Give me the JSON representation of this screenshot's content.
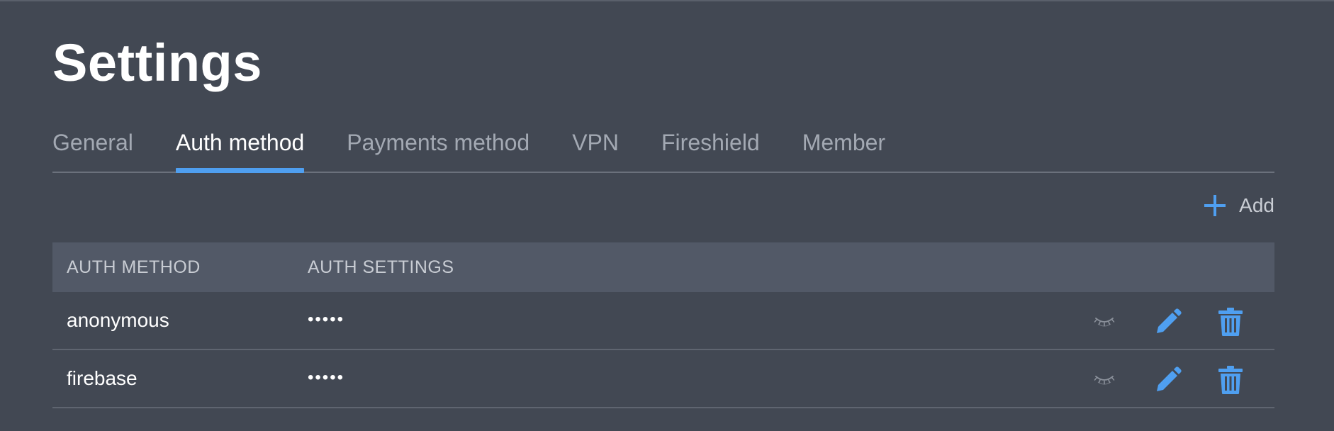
{
  "page": {
    "title": "Settings"
  },
  "tabs": [
    {
      "label": "General",
      "active": false
    },
    {
      "label": "Auth method",
      "active": true
    },
    {
      "label": "Payments method",
      "active": false
    },
    {
      "label": "VPN",
      "active": false
    },
    {
      "label": "Fireshield",
      "active": false
    },
    {
      "label": "Member",
      "active": false
    }
  ],
  "toolbar": {
    "add_label": "Add",
    "add_icon": "plus-icon"
  },
  "table": {
    "columns": [
      "AUTH METHOD",
      "AUTH SETTINGS"
    ],
    "rows": [
      {
        "method": "anonymous",
        "settings": "•••••",
        "actions": [
          "eye-closed-icon",
          "pencil-icon",
          "trash-icon"
        ]
      },
      {
        "method": "firebase",
        "settings": "•••••",
        "actions": [
          "eye-closed-icon",
          "pencil-icon",
          "trash-icon"
        ]
      }
    ]
  },
  "colors": {
    "background": "#424853",
    "accent": "#4f9ff0",
    "table_header": "#525967",
    "muted_text": "#a3a9b3",
    "muted_icon": "#8a909a"
  }
}
